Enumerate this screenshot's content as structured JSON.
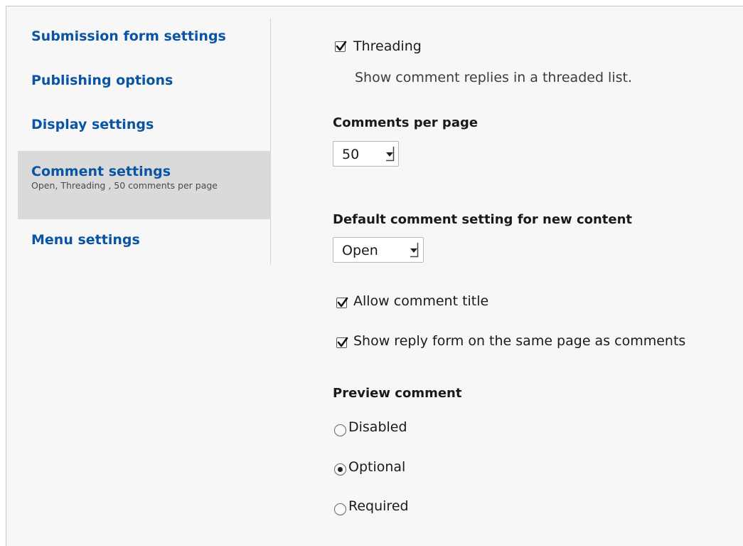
{
  "tabs": [
    {
      "label": "Submission form settings",
      "summary": ""
    },
    {
      "label": "Publishing options",
      "summary": ""
    },
    {
      "label": "Display settings",
      "summary": ""
    },
    {
      "label": "Comment settings",
      "summary": "Open, Threading , 50 comments per page",
      "active": true
    },
    {
      "label": "Menu settings",
      "summary": ""
    }
  ],
  "threading": {
    "label": "Threading",
    "checked": true,
    "description": "Show comment replies in a threaded list."
  },
  "comments_per_page": {
    "label": "Comments per page",
    "value": "50"
  },
  "default_setting": {
    "label": "Default comment setting for new content",
    "value": "Open"
  },
  "allow_title": {
    "label": "Allow comment title",
    "checked": true
  },
  "show_reply_form": {
    "label": "Show reply form on the same page as comments",
    "checked": true
  },
  "preview": {
    "label": "Preview comment",
    "options": [
      "Disabled",
      "Optional",
      "Required"
    ],
    "selected": "Optional"
  },
  "colors": {
    "link": "#0a55a3",
    "active_tab_bg": "#dadada",
    "panel_bg": "#f7f7f7"
  }
}
